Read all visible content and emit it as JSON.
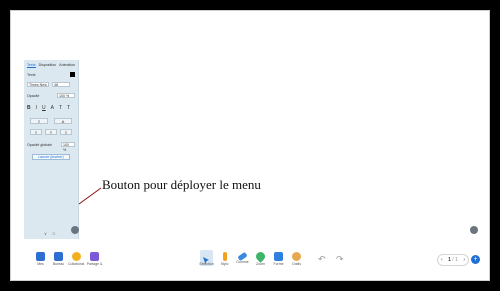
{
  "panel": {
    "tabs": [
      "Texte",
      "Disposition",
      "Animation"
    ],
    "text_label": "Texte",
    "font": "Times New",
    "size": "48",
    "opacity_label": "Opacité",
    "opacity": "100 %",
    "format_buttons": [
      "B",
      "I",
      "U",
      "A",
      "T",
      "T"
    ],
    "align_buttons": [
      "≡",
      "A",
      "≡",
      "≡",
      "≡"
    ],
    "global_opacity_label": "Opacité globale",
    "global_opacity": "100 %",
    "link_button": "Lancer (insérer)",
    "footer": [
      "∨",
      "⊃"
    ]
  },
  "annotation": {
    "text": "Bouton pour déployer le menu"
  },
  "toolbar": {
    "left": [
      {
        "label": "Mes",
        "color": "#2c6fd1"
      },
      {
        "label": "Bureau",
        "color": "#2c6fd1"
      },
      {
        "label": "Collaborat.",
        "color": "#f2b01e"
      },
      {
        "label": "Partage &",
        "color": "#7b5cd6"
      }
    ],
    "center": [
      {
        "label": "Sélection",
        "color": "#1f6fd6"
      },
      {
        "label": "Stylo",
        "color": "#f2a31e"
      },
      {
        "label": "Gomme",
        "color": "#3a8be0"
      },
      {
        "label": "Zoom",
        "color": "#3cb56b"
      },
      {
        "label": "Forme",
        "color": "#2f7fe0"
      },
      {
        "label": "Outils",
        "color": "#e7a850"
      }
    ],
    "undo": "↶",
    "redo": "↷",
    "page": "1",
    "page_total": "/ 1",
    "prev": "‹",
    "next": "›",
    "add": "+"
  }
}
